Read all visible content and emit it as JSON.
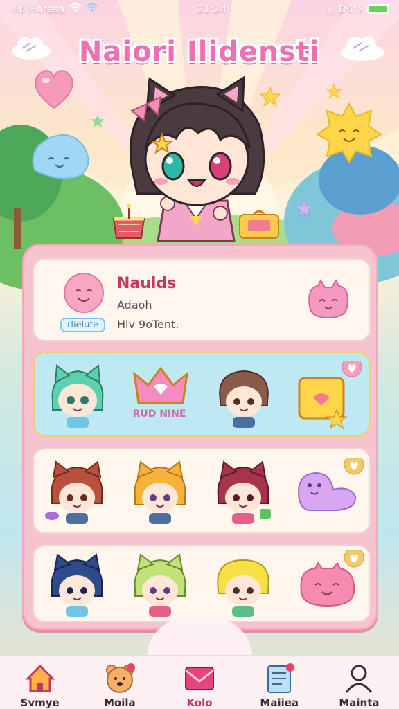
{
  "status_bar": {
    "carrier": "·ıl6 Haresa",
    "time": "21:24",
    "battery": "D6%",
    "battery_level": 0.96
  },
  "title": "Naiori Ilidensti",
  "profile": {
    "name": "Naulds",
    "line1": "Adaoh",
    "line2": "Hlv 9oTent.",
    "tag": "rlielufe"
  },
  "row1": {
    "banner": "RUD NINE"
  },
  "nav": {
    "items": [
      {
        "label": "Svmye",
        "icon": "home-icon"
      },
      {
        "label": "Moila",
        "icon": "bear-icon"
      },
      {
        "label": "Kolo",
        "icon": "mail-icon"
      },
      {
        "label": "Maiiea",
        "icon": "notebook-icon"
      },
      {
        "label": "Mainta",
        "icon": "profile-icon"
      }
    ],
    "active": 2
  },
  "colors": {
    "accent": "#c8365e",
    "panel": "#f7c3cf",
    "title": "#f06fb2"
  }
}
